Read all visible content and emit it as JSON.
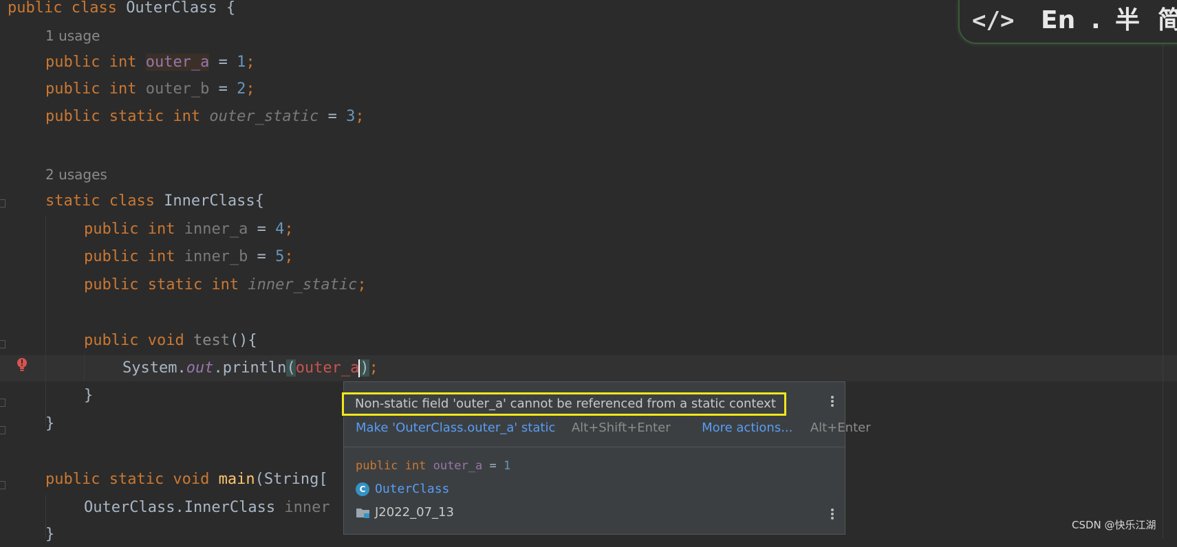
{
  "editor": {
    "lines": {
      "l1": {
        "kw": "public class ",
        "name": "OuterClass",
        "brace": " {"
      },
      "hint1": "1 usage",
      "l2": {
        "kw": "public int ",
        "field": "outer_a",
        "eq": " = ",
        "num": "1",
        "semi": ";"
      },
      "l3": {
        "kw": "public int ",
        "field": "outer_b",
        "eq": " = ",
        "num": "2",
        "semi": ";"
      },
      "l4": {
        "kw": "public static int ",
        "field": "outer_static",
        "eq": " = ",
        "num": "3",
        "semi": ";"
      },
      "hint2": "2 usages",
      "l5": {
        "kw": "static class ",
        "name": "InnerClass",
        "brace": "{"
      },
      "l6": {
        "kw": "public int ",
        "field": "inner_a",
        "eq": " = ",
        "num": "4",
        "semi": ";"
      },
      "l7": {
        "kw": "public int ",
        "field": "inner_b",
        "eq": " = ",
        "num": "5",
        "semi": ";"
      },
      "l8": {
        "kw": "public static int ",
        "field": "inner_static",
        "semi": ";"
      },
      "l9": {
        "kw": "public void ",
        "name": "test",
        "rest": "(){"
      },
      "l10": {
        "sys": "System.",
        "out": "out",
        "println": ".println",
        "open": "(",
        "err": "outer_a",
        "close": ")",
        "semi": ";"
      },
      "l11": "}",
      "l12": "}",
      "l13": {
        "kw": "public static void ",
        "name": "main",
        "rest": "(String["
      },
      "l14": {
        "type": "OuterClass.InnerClass ",
        "var": "inner"
      },
      "l15": "}"
    }
  },
  "ime_toolbar": {
    "code_icon": "</>",
    "lang": "En",
    "punct": ".",
    "width_mode": "半",
    "script": "简"
  },
  "popup": {
    "message": "Non-static field 'outer_a' cannot be referenced from a static context",
    "fix_action": "Make 'OuterClass.outer_a' static",
    "fix_shortcut": "Alt+Shift+Enter",
    "more_actions": "More actions...",
    "more_shortcut": "Alt+Enter",
    "decl": {
      "kw": "public int ",
      "field": "outer_a",
      "eq": " = ",
      "num": "1"
    },
    "class_icon_letter": "C",
    "class_name": "OuterClass",
    "module": "J2022_07_13"
  },
  "watermark": "CSDN @快乐江湖",
  "colors": {
    "background": "#2b2b2b",
    "keyword": "#cc7832",
    "number": "#6897bb",
    "field": "#9876aa",
    "error": "#c75450",
    "link": "#589df6",
    "highlight_border": "#f0e81c"
  }
}
